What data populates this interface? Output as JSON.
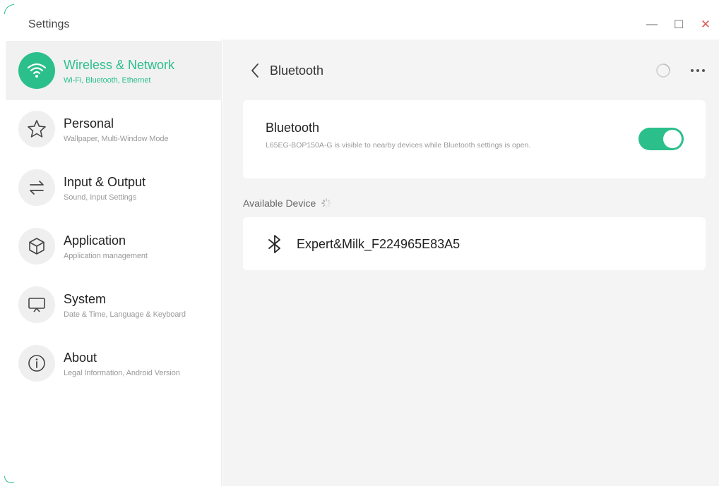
{
  "window": {
    "title": "Settings",
    "minimize": "—",
    "maximize": "☐",
    "close": "✕"
  },
  "sidebar": {
    "items": [
      {
        "label": "Wireless & Network",
        "sub": "Wi-Fi, Bluetooth, Ethernet",
        "icon": "wifi-icon",
        "active": true
      },
      {
        "label": "Personal",
        "sub": "Wallpaper, Multi-Window Mode",
        "icon": "star-icon",
        "active": false
      },
      {
        "label": "Input & Output",
        "sub": "Sound, Input Settings",
        "icon": "swap-arrows-icon",
        "active": false
      },
      {
        "label": "Application",
        "sub": "Application management",
        "icon": "cube-icon",
        "active": false
      },
      {
        "label": "System",
        "sub": "Date & Time, Language & Keyboard",
        "icon": "monitor-icon",
        "active": false
      },
      {
        "label": "About",
        "sub": "Legal Information, Android Version",
        "icon": "info-icon",
        "active": false
      }
    ]
  },
  "header": {
    "title": "Bluetooth"
  },
  "bluetooth": {
    "title": "Bluetooth",
    "description": "L65EG-BOP150A-G is visible to nearby devices while Bluetooth settings is open.",
    "enabled": true
  },
  "available": {
    "label": "Available Device",
    "devices": [
      {
        "name": "Expert&Milk_F224965E83A5",
        "icon": "bluetooth-icon"
      }
    ]
  },
  "colors": {
    "accent": "#2bbf8c",
    "close": "#e05a5a",
    "content_bg": "#f4f4f4"
  }
}
